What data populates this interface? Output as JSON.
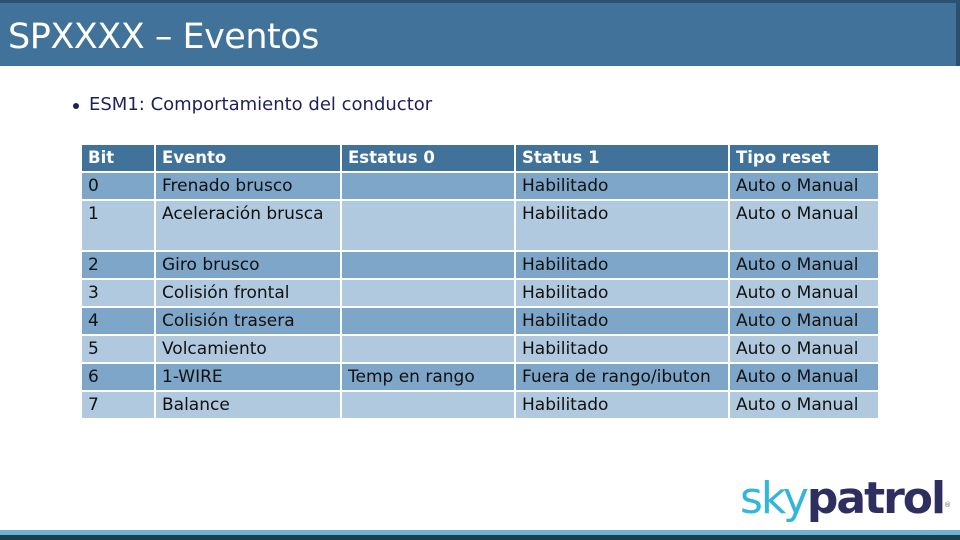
{
  "slide": {
    "title": "SPXXXX – Eventos",
    "bullet": "ESM1: Comportamiento del conductor"
  },
  "table": {
    "headers": [
      "Bit",
      "Evento",
      "Estatus 0",
      "Status 1",
      "Tipo reset"
    ],
    "rows": [
      {
        "bit": "0",
        "evento": "Frenado brusco",
        "estatus0": "",
        "status1": "Habilitado",
        "reset": "Auto o Manual"
      },
      {
        "bit": "1",
        "evento": "Aceleración brusca",
        "estatus0": "",
        "status1": "Habilitado",
        "reset": "Auto o Manual"
      },
      {
        "bit": "2",
        "evento": "Giro brusco",
        "estatus0": "",
        "status1": "Habilitado",
        "reset": "Auto o Manual"
      },
      {
        "bit": "3",
        "evento": "Colisión frontal",
        "estatus0": "",
        "status1": "Habilitado",
        "reset": "Auto o Manual"
      },
      {
        "bit": "4",
        "evento": "Colisión trasera",
        "estatus0": "",
        "status1": "Habilitado",
        "reset": "Auto o Manual"
      },
      {
        "bit": "5",
        "evento": "Volcamiento",
        "estatus0": "",
        "status1": "Habilitado",
        "reset": "Auto o Manual"
      },
      {
        "bit": "6",
        "evento": "1-WIRE",
        "estatus0": "Temp en rango",
        "status1": "Fuera de rango/ibuton",
        "reset": "Auto o Manual"
      },
      {
        "bit": "7",
        "evento": "Balance",
        "estatus0": "",
        "status1": "Habilitado",
        "reset": "Auto o Manual"
      }
    ]
  },
  "logo": {
    "part1": "sky",
    "part2": "patrol",
    "mark": "®"
  },
  "colors": {
    "title_bar": "#41729a",
    "header_row": "#41729a",
    "row_dark": "#7ea6c8",
    "row_light": "#b0c9de",
    "logo_sky": "#33b5dc",
    "logo_patrol": "#2e2f5e",
    "bottom_light": "#6db3d1",
    "bottom_dark": "#1d3d50"
  }
}
